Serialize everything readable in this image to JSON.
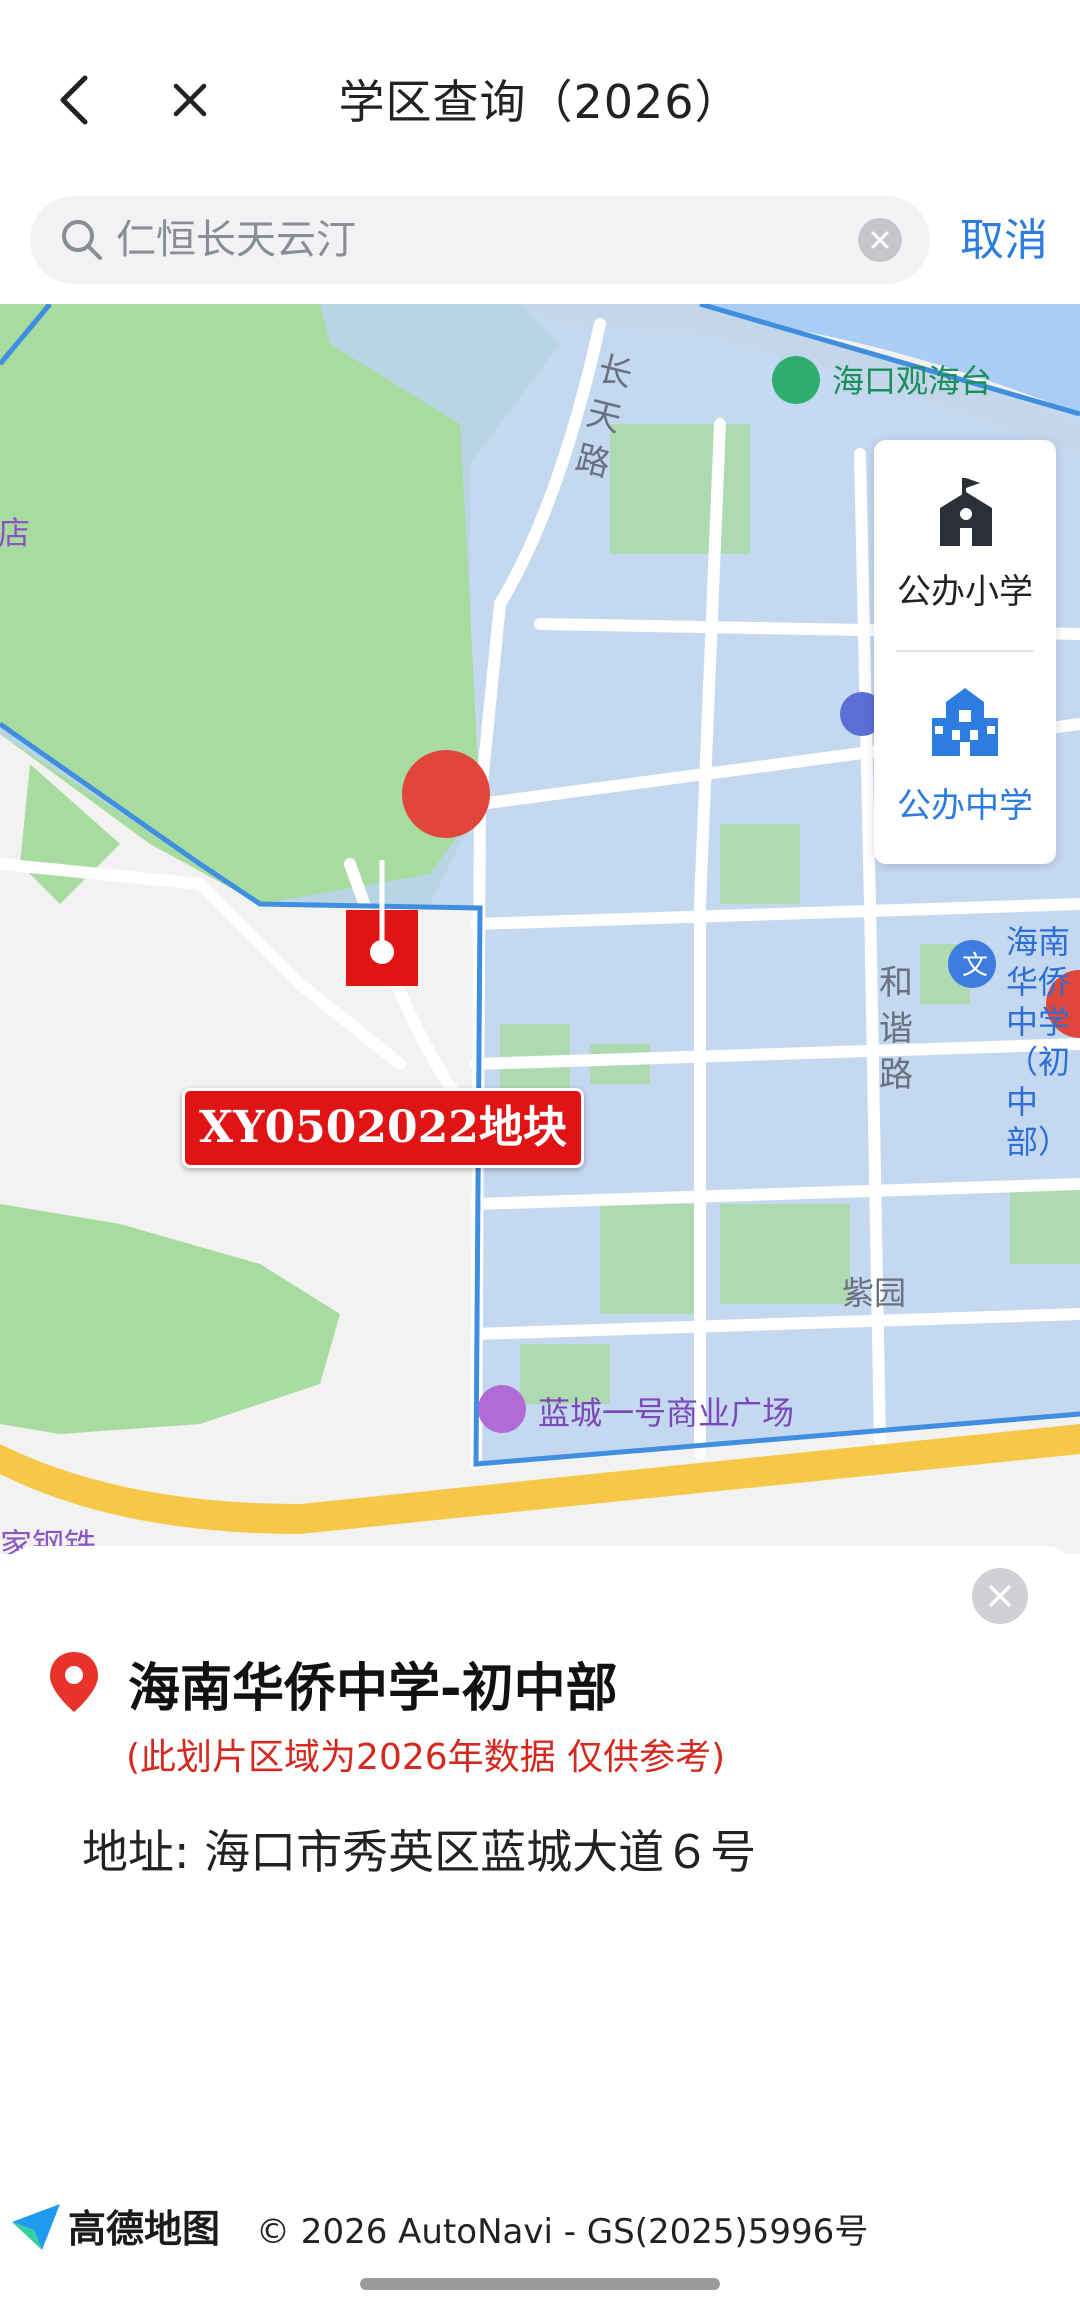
{
  "header": {
    "title": "学区查询（2026）",
    "back_icon": "chevron-left-icon",
    "close_icon": "close-icon"
  },
  "search": {
    "value": "仁恒长天云汀",
    "cancel_label": "取消"
  },
  "map": {
    "labels": {
      "haikou_tower": "海口观海台",
      "hotel_partial": "酒店",
      "changtian_road": "长天路",
      "hexie_road": "和谐路",
      "ziyuan": "紫园",
      "lancheng_plaza": "蓝城一号商业广场",
      "steel_partial": "家钢铁",
      "school_marker_partial": "海南华侨中学（初中部）",
      "plot_label": "XY0502022地块"
    },
    "school_types": [
      {
        "label": "公办小学",
        "icon": "school-building-icon",
        "selected": false
      },
      {
        "label": "公办中学",
        "icon": "school-building-icon",
        "selected": true
      }
    ],
    "colors": {
      "district_fill": "#bcd4f0",
      "district_border": "#3f8ee0",
      "green": "#a8dba0",
      "road": "#ffffff",
      "highway": "#f7c847"
    }
  },
  "info": {
    "school_name": "海南华侨中学-初中部",
    "note": "(此划片区域为2026年数据 仅供参考)",
    "address_label": "地址:",
    "address_value": "海口市秀英区蓝城大道６号"
  },
  "footer": {
    "amap_name": "高德地图",
    "copyright": "© 2026 AutoNavi - GS(2025)5996号"
  }
}
